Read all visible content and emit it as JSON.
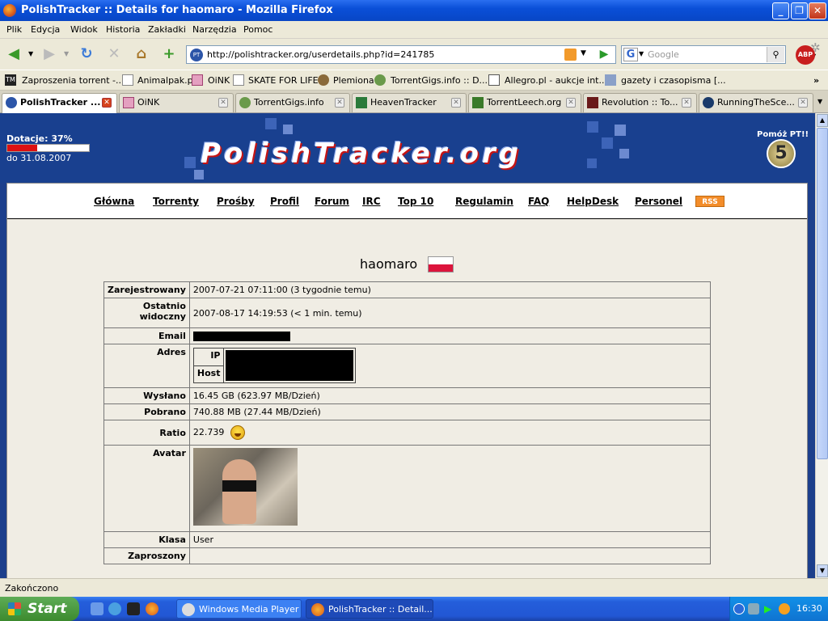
{
  "window": {
    "title": "PolishTracker :: Details for haomaro - Mozilla Firefox"
  },
  "menu": [
    "Plik",
    "Edycja",
    "Widok",
    "Historia",
    "Zakładki",
    "Narzędzia",
    "Pomoc"
  ],
  "nav": {
    "url": "http://polishtracker.org/userdetails.php?id=241785",
    "search_placeholder": "Google",
    "abp": "ABP",
    "favicon": "PT"
  },
  "bookmarks": [
    {
      "label": "Zaproszenia torrent -...",
      "icon": "tm-icon"
    },
    {
      "label": "Animalpak.pl",
      "icon": "page-icon"
    },
    {
      "label": "OiNK",
      "icon": "oink-icon"
    },
    {
      "label": "SKATE FOR LIFE",
      "icon": "page-icon"
    },
    {
      "label": "Plemiona",
      "icon": "plemiona-icon"
    },
    {
      "label": "TorrentGigs.info :: D...",
      "icon": "torrentgigs-icon"
    },
    {
      "label": "Allegro.pl - aukcje int...",
      "icon": "allegro-icon"
    },
    {
      "label": "gazety i czasopisma [...",
      "icon": "magazine-icon"
    }
  ],
  "bookmarks_more": "»",
  "tabs": [
    {
      "label": "PolishTracker ...",
      "active": true
    },
    {
      "label": "OiNK",
      "active": false
    },
    {
      "label": "TorrentGigs.info",
      "active": false
    },
    {
      "label": "HeavenTracker",
      "active": false
    },
    {
      "label": "TorrentLeech.org",
      "active": false
    },
    {
      "label": "Revolution :: To...",
      "active": false
    },
    {
      "label": "RunningTheSce...",
      "active": false
    }
  ],
  "site": {
    "donation_label": "Dotacje: 37%",
    "donation_percent": 37,
    "donation_until": "do 31.08.2007",
    "logo_text": "PolishTracker.org",
    "help_label": "Pomóż PT!!",
    "help_badge": "5",
    "menu": [
      "Główna",
      "Torrenty",
      "Prośby",
      "Profil",
      "Forum",
      "IRC",
      "Top 10",
      "Regulamin",
      "FAQ",
      "HelpDesk",
      "Personel"
    ],
    "rss": "RSS",
    "username": "haomaro"
  },
  "profile": {
    "registered_label": "Zarejestrowany",
    "registered_value": "2007-07-21 07:11:00 (3 tygodnie temu)",
    "lastseen_label": "Ostatnio widoczny",
    "lastseen_value": "2007-08-17 14:19:53 (< 1 min. temu)",
    "email_label": "Email",
    "address_label": "Adres",
    "ip_label": "IP",
    "host_label": "Host",
    "uploaded_label": "Wysłano",
    "uploaded_value": "16.45 GB (623.97 MB/Dzień)",
    "downloaded_label": "Pobrano",
    "downloaded_value": "740.88 MB (27.44 MB/Dzień)",
    "ratio_label": "Ratio",
    "ratio_value": "22.739",
    "avatar_label": "Avatar",
    "class_label": "Klasa",
    "class_value": "User",
    "invited_label": "Zaproszony"
  },
  "status": "Zakończono",
  "taskbar": {
    "start": "Start",
    "items": [
      "Windows Media Player",
      "PolishTracker :: Detail..."
    ],
    "clock": "16:30"
  }
}
